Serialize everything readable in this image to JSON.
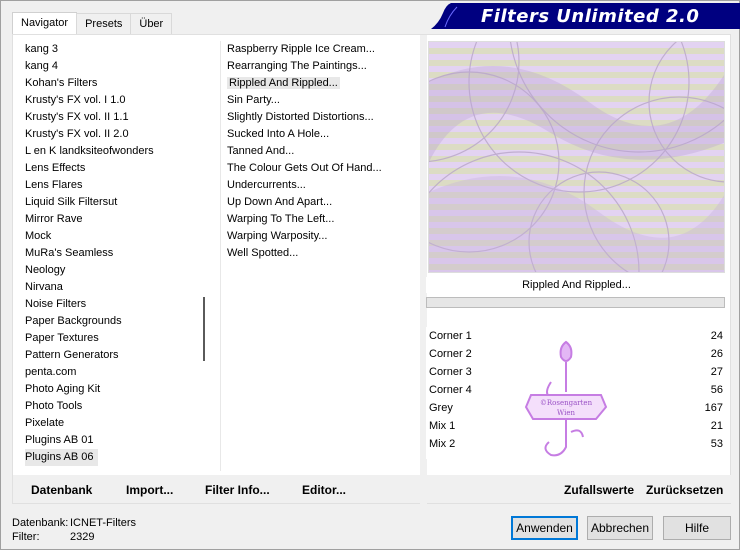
{
  "tabs": [
    {
      "label": "Navigator"
    },
    {
      "label": "Presets"
    },
    {
      "label": "Über"
    }
  ],
  "banner": {
    "title": "Filters Unlimited 2.0",
    "color": "#000080"
  },
  "categories": [
    "kang 3",
    "kang 4",
    "Kohan's Filters",
    "Krusty's FX vol. I 1.0",
    "Krusty's FX vol. II 1.1",
    "Krusty's FX vol. II 2.0",
    "L en K landksiteofwonders",
    "Lens Effects",
    "Lens Flares",
    "Liquid Silk Filtersut",
    "Mirror Rave",
    "Mock",
    "MuRa's Seamless",
    "Neology",
    "Nirvana",
    "Noise Filters",
    "Paper Backgrounds",
    "Paper Textures",
    "Pattern Generators",
    "penta.com",
    "Photo Aging Kit",
    "Photo Tools",
    "Pixelate",
    "Plugins AB 01",
    "Plugins AB 06"
  ],
  "selected_category": "Plugins AB 06",
  "filters": [
    "Raspberry Ripple Ice Cream...",
    "Rearranging The Paintings...",
    "Rippled And Rippled...",
    "Sin Party...",
    "Slightly Distorted Distortions...",
    "Sucked Into A Hole...",
    "Tanned And...",
    "The Colour Gets Out Of Hand...",
    "Undercurrents...",
    "Up Down And Apart...",
    "Warping To The Left...",
    "Warping Warposity...",
    "Well Spotted..."
  ],
  "selected_filter": "Rippled And Rippled...",
  "preview_label": "Rippled And Rippled...",
  "params": [
    {
      "label": "Corner 1",
      "value": "24"
    },
    {
      "label": "Corner 2",
      "value": "26"
    },
    {
      "label": "Corner 3",
      "value": "27"
    },
    {
      "label": "Corner 4",
      "value": "56"
    },
    {
      "label": "Grey",
      "value": "167"
    },
    {
      "label": "Mix 1",
      "value": "21"
    },
    {
      "label": "Mix 2",
      "value": "53"
    }
  ],
  "watermark": {
    "line1": "©Rosengarten",
    "line2": "Wien"
  },
  "bottom_left_buttons": {
    "database": "Datenbank",
    "import": "Import...",
    "filter_info": "Filter Info...",
    "editor": "Editor..."
  },
  "bottom_right_buttons": {
    "random": "Zufallswerte",
    "reset": "Zurücksetzen"
  },
  "status": {
    "db_key": "Datenbank:",
    "db_value": "ICNET-Filters",
    "filter_key": "Filter:",
    "filter_value": "2329"
  },
  "dialog_buttons": {
    "apply": "Anwenden",
    "cancel": "Abbrechen",
    "help": "Hilfe"
  },
  "colors": {
    "accent": "#0078d7",
    "lavender": "#d4b8ec",
    "olive": "#d9dbb6"
  }
}
